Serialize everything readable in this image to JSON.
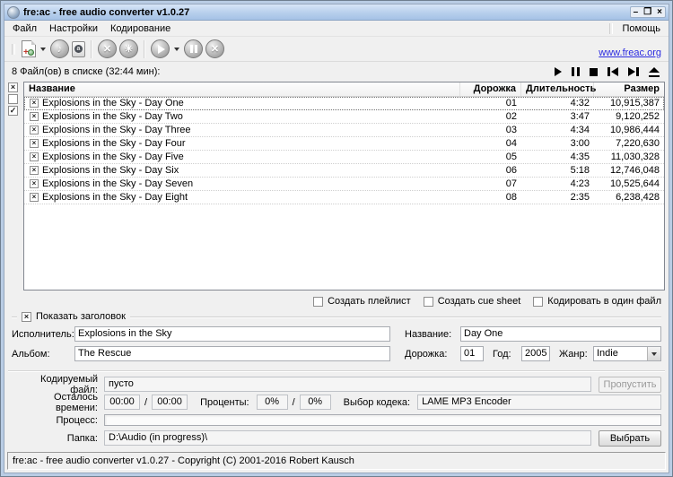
{
  "window": {
    "title": "fre:ac - free audio converter v1.0.27",
    "controls": {
      "minimize": "–",
      "maximize": "❐",
      "close": "×"
    }
  },
  "menu": {
    "file": "Файл",
    "settings": "Настройки",
    "encoding": "Кодирование",
    "help": "Помощь"
  },
  "toolbar": {
    "link": "www.freac.org",
    "icons": [
      "add-files-icon",
      "music-note-icon",
      "cd-case-icon",
      "tools-icon",
      "gear-icon",
      "play-icon",
      "pause-icon",
      "stop-icon"
    ],
    "music_note_glyph": "♪",
    "tools_glyph": "✕",
    "gear_glyph": "✳",
    "stop_glyph": "✕",
    "plus_glyph": "+",
    "case_letter": "a"
  },
  "joblist": {
    "summary": "8 Файл(ов) в списке (32:44 мин):",
    "columns": {
      "title": "Название",
      "track": "Дорожка",
      "duration": "Длительность",
      "size": "Размер"
    },
    "side_checks": {
      "all": "×",
      "none": "",
      "toggle": "✓"
    },
    "row_check": "×",
    "rows": [
      {
        "title": "Explosions in the Sky - Day One",
        "track": "01",
        "duration": "4:32",
        "size": "10,915,387"
      },
      {
        "title": "Explosions in the Sky - Day Two",
        "track": "02",
        "duration": "3:47",
        "size": "9,120,252"
      },
      {
        "title": "Explosions in the Sky - Day Three",
        "track": "03",
        "duration": "4:34",
        "size": "10,986,444"
      },
      {
        "title": "Explosions in the Sky - Day Four",
        "track": "04",
        "duration": "3:00",
        "size": "7,220,630"
      },
      {
        "title": "Explosions in the Sky - Day Five",
        "track": "05",
        "duration": "4:35",
        "size": "11,030,328"
      },
      {
        "title": "Explosions in the Sky - Day Six",
        "track": "06",
        "duration": "5:18",
        "size": "12,746,048"
      },
      {
        "title": "Explosions in the Sky - Day Seven",
        "track": "07",
        "duration": "4:23",
        "size": "10,525,644"
      },
      {
        "title": "Explosions in the Sky - Day Eight",
        "track": "08",
        "duration": "2:35",
        "size": "6,238,428"
      }
    ]
  },
  "options": {
    "playlist": "Создать плейлист",
    "cuesheet": "Создать cue sheet",
    "single_file": "Кодировать в один файл"
  },
  "tags": {
    "legend_check": "×",
    "legend": "Показать заголовок",
    "artist_label": "Исполнитель:",
    "artist": "Explosions in the Sky",
    "album_label": "Альбом:",
    "album": "The Rescue",
    "title_label": "Название:",
    "title": "Day One",
    "track_label": "Дорожка:",
    "track": "01",
    "year_label": "Год:",
    "year": "2005",
    "genre_label": "Жанр:",
    "genre": "Indie"
  },
  "encoding": {
    "file_label": "Кодируемый файл:",
    "file": "пусто",
    "time_label": "Осталось времени:",
    "time_elapsed": "00:00",
    "time_total": "00:00",
    "slash": "/",
    "percent_label": "Проценты:",
    "percent_track": "0%",
    "percent_total": "0%",
    "codec_label": "Выбор кодека:",
    "codec": "LAME MP3 Encoder",
    "progress_label": "Процесс:",
    "folder_label": "Папка:",
    "folder": "D:\\Audio (in progress)\\",
    "skip_button": "Пропустить",
    "browse_button": "Выбрать"
  },
  "statusbar": {
    "text": "fre:ac - free audio converter v1.0.27 - Copyright (C) 2001-2016 Robert Kausch"
  },
  "colors": {
    "titlebar": "#b7cfec",
    "link": "#2a2ae0",
    "list_border": "#828790"
  }
}
